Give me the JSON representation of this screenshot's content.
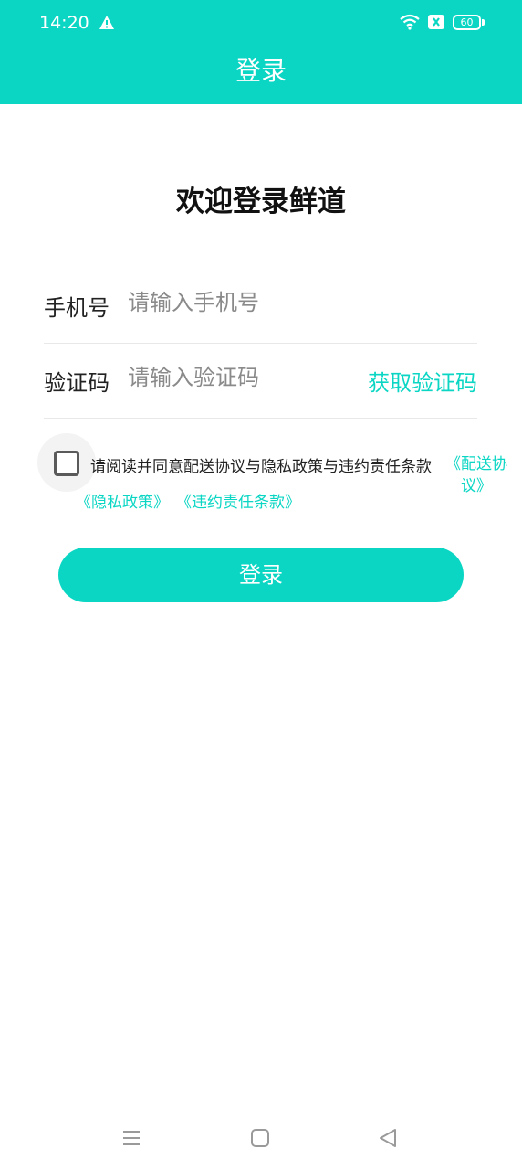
{
  "status_bar": {
    "time": "14:20",
    "battery": "60",
    "icons": [
      "warning-icon",
      "wifi-icon",
      "sim-card-icon",
      "battery-icon"
    ]
  },
  "header": {
    "title": "登录"
  },
  "welcome": "欢迎登录鲜道",
  "form": {
    "phone": {
      "label": "手机号",
      "placeholder": "请输入手机号"
    },
    "code": {
      "label": "验证码",
      "placeholder": "请输入验证码",
      "get_code": "获取验证码"
    }
  },
  "agreement": {
    "text": "请阅读并同意配送协议与隐私政策与违约责任条款",
    "link_delivery": "《配送协议》",
    "link_privacy": "《隐私政策》",
    "link_violation": "《违约责任条款》"
  },
  "login_button": "登录",
  "nav_bar": {
    "icons": [
      "menu-icon",
      "home-icon",
      "back-icon"
    ]
  },
  "colors": {
    "accent": "#0bd6c4",
    "text": "#222222",
    "placeholder": "#8a8a8a"
  }
}
